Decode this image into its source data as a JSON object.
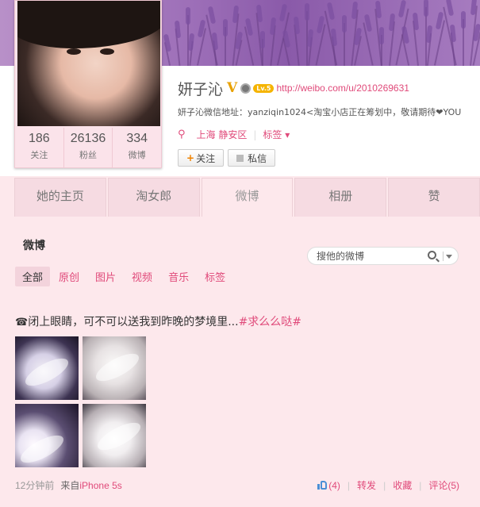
{
  "profile": {
    "name": "妍子沁",
    "verified_badge": "V",
    "level_badge": "Lv.5",
    "url": "http://weibo.com/u/2010269631",
    "description": "妍子沁微信地址：yanziqin1024<淘宝小店正在筹划中，敬请期待❤YOU",
    "location": "上海 静安区",
    "tags_label": "标签",
    "follow_button": "关注",
    "message_button": "私信",
    "pin_icon": "location-pin-icon"
  },
  "stats": [
    {
      "value": "186",
      "label": "关注"
    },
    {
      "value": "26136",
      "label": "粉丝"
    },
    {
      "value": "334",
      "label": "微博"
    }
  ],
  "tabs": [
    {
      "label": "她的主页"
    },
    {
      "label": "淘女郎"
    },
    {
      "label": "微博"
    },
    {
      "label": "相册"
    },
    {
      "label": "赞"
    }
  ],
  "active_tab": "微博",
  "feed": {
    "title": "微博",
    "search_placeholder": "搜他的微博",
    "filters": [
      {
        "label": "全部"
      },
      {
        "label": "原创"
      },
      {
        "label": "图片"
      },
      {
        "label": "视频"
      },
      {
        "label": "音乐"
      },
      {
        "label": "标签"
      }
    ],
    "active_filter": "全部"
  },
  "post": {
    "icon": "☎",
    "text": "闭上眼睛，可不可以送我到昨晚的梦境里...",
    "hashtag": "#求么么哒#",
    "time": "12分钟前",
    "from_label": "来自",
    "source": "iPhone 5s",
    "likes": "(4)",
    "repost": "转发",
    "favorite": "收藏",
    "comment": "评论(5)"
  },
  "colors": {
    "accent": "#e04a7a",
    "background": "#fde8ec",
    "tab_inactive": "#f6dbe2",
    "verified": "#e8a100"
  }
}
